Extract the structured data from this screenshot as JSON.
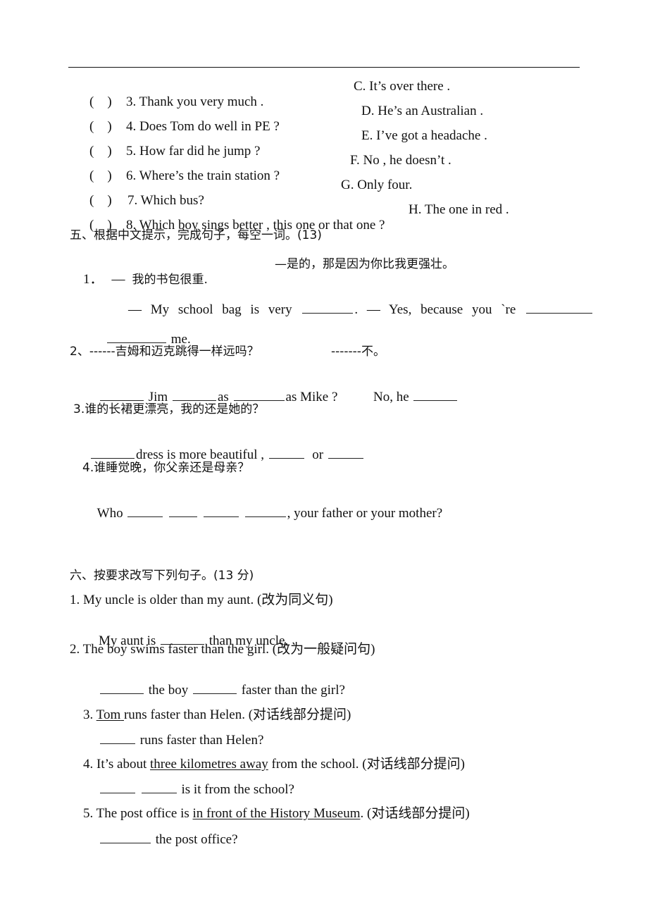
{
  "matching": {
    "items": [
      {
        "paren": "(    )",
        "question": "3. Thank you very much .",
        "answer": "C. It’s over there ."
      },
      {
        "paren": "(    )",
        "question": "4. Does Tom do well in PE ?",
        "answer": "D. He’s an Australian ."
      },
      {
        "paren": "(    )",
        "question": "5. How far did he jump ?",
        "answer": "E. I’ve got a headache ."
      },
      {
        "paren": "(    )",
        "question": "6. Where’s the train station ?",
        "answer": "F. No , he doesn’t ."
      },
      {
        "paren": "(    )",
        "question": "7. Which bus?",
        "answer": "G. Only four."
      },
      {
        "paren": "(    )",
        "question": "8. Which boy sings better , this one or that one ?",
        "answer": "H. The one in red ."
      }
    ]
  },
  "section5": {
    "title": "五、根据中文提示，完成句子，每空一词。(13)",
    "q1": {
      "num": "1．",
      "dash1": "—",
      "cn_a": "我的书包很重.",
      "cn_b": "—是的，那是因为你比我更强壮。",
      "en_a": "— My school bag is very",
      "en_mid": ". — Yes, because you `re",
      "en_end": "me."
    },
    "q2": {
      "cn": "2、------吉姆和迈克跳得一样远吗？",
      "cn_b": "-------不。",
      "w1": "Jim",
      "w2": "as",
      "w3": "as Mike ?",
      "w4": "No, he"
    },
    "q3": {
      "cn": "3.谁的长裙更漂亮，我的还是她的？",
      "w1": "dress is more beautiful ,",
      "w2": "or"
    },
    "q4": {
      "cn": "4.谁睡觉晚，你父亲还是母亲？",
      "w1": "Who",
      "w2": ", your father or your mother?"
    }
  },
  "section6": {
    "title": "六、按要求改写下列句子。(13 分)",
    "q1": {
      "prompt": "1. My uncle is older than my aunt. (改为同义句)",
      "a1": "My aunt is",
      "a2": "than my uncle."
    },
    "q2": {
      "prompt": "2. The boy swims faster than the girl. (改为一般疑问句)",
      "a1": "the boy",
      "a2": "faster than the girl?"
    },
    "q3": {
      "num": "3.",
      "underlined": "Tom",
      "rest": "runs faster than Helen. (对话线部分提问)",
      "a1": "runs faster than Helen?"
    },
    "q4": {
      "pre": "4. It’s about",
      "underlined": "three kilometres away",
      "rest": "from the school. (对话线部分提问)",
      "a1": "is it from the school?"
    },
    "q5": {
      "pre": "5. The post office is",
      "underlined": "in front of the History Museum",
      "rest": ". (对话线部分提问)",
      "a1": "the post office?"
    }
  }
}
